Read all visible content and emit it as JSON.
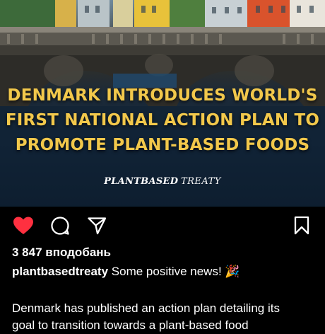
{
  "post": {
    "headline_lines": [
      "DENMARK INTRODUCES WORLD'S",
      "FIRST NATIONAL ACTION PLAN TO",
      "PROMOTE PLANT-BASED FOODS"
    ],
    "brand_part1": "PLANTBASED",
    "brand_part2": "TREATY",
    "likes_text": "3 847 вподобань",
    "caption_user": "plantbasedtreaty",
    "caption_text": "Some positive news! 🎉",
    "body_line1": "Denmark has published an action plan detailing its",
    "body_line2": "goal to transition towards a plant-based food"
  },
  "colors": {
    "headline": "#f2c84b",
    "like_active": "#ff3040",
    "background": "#000000"
  },
  "icons": [
    "heart-icon",
    "comment-icon",
    "share-icon",
    "bookmark-icon"
  ]
}
